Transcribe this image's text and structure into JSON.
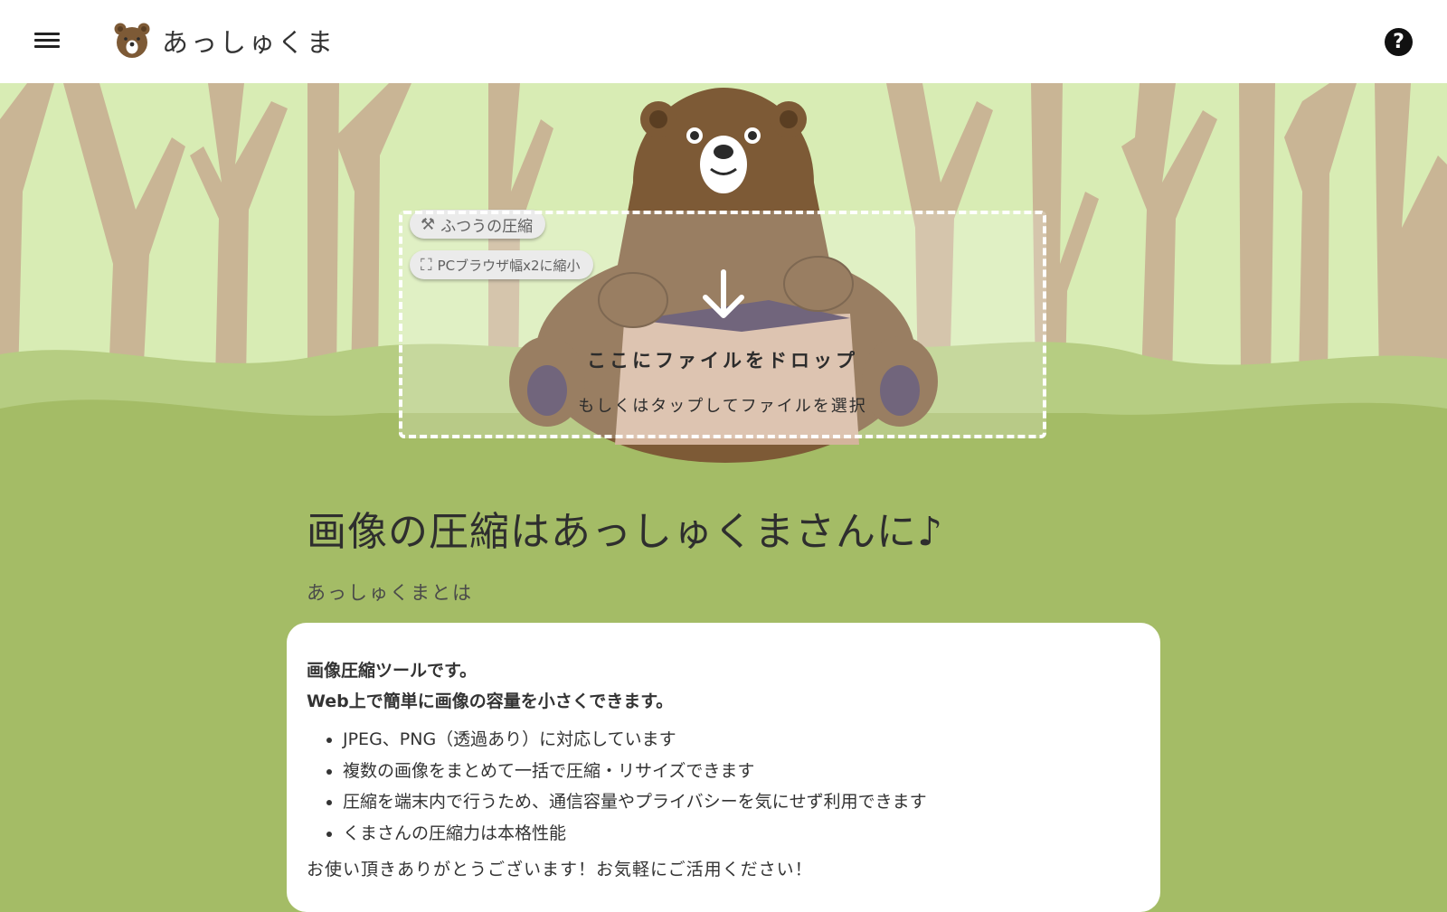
{
  "header": {
    "app_name": "あっしゅくま",
    "menu_icon": "hamburger-icon",
    "logo_icon": "bear-face-icon",
    "help_icon": "question-circle-icon",
    "help_label": "?"
  },
  "hero": {
    "mode_buttons": [
      {
        "icon": "hammer-icon",
        "label": "ふつうの圧縮"
      },
      {
        "icon": "resize-icon",
        "label": "PCブラウザ幅x2に縮小"
      }
    ],
    "dropzone": {
      "icon": "arrow-down-icon",
      "main_text": "ここにファイルをドロップ",
      "sub_text": "もしくはタップしてファイルを選択"
    }
  },
  "main": {
    "title": "画像の圧縮はあっしゅくまさんに♪",
    "about_heading": "あっしゅくまとは",
    "intro_lines": [
      "画像圧縮ツールです。",
      "Web上で簡単に画像の容量を小さくできます。"
    ],
    "features": [
      "JPEG、PNG（透過あり）に対応しています",
      "複数の画像をまとめて一括で圧縮・リサイズできます",
      "圧縮を端末内で行うため、通信容量やプライバシーを気にせず利用できます",
      "くまさんの圧縮力は本格性能"
    ],
    "thanks": "お使い頂きありがとうございます！お気軽にご活用ください！"
  },
  "colors": {
    "sky": "#d8ecb4",
    "trees": "#c9b595",
    "grass": "#a4bc66",
    "bear": "#7d5a36",
    "header_bg": "#ffffff"
  }
}
